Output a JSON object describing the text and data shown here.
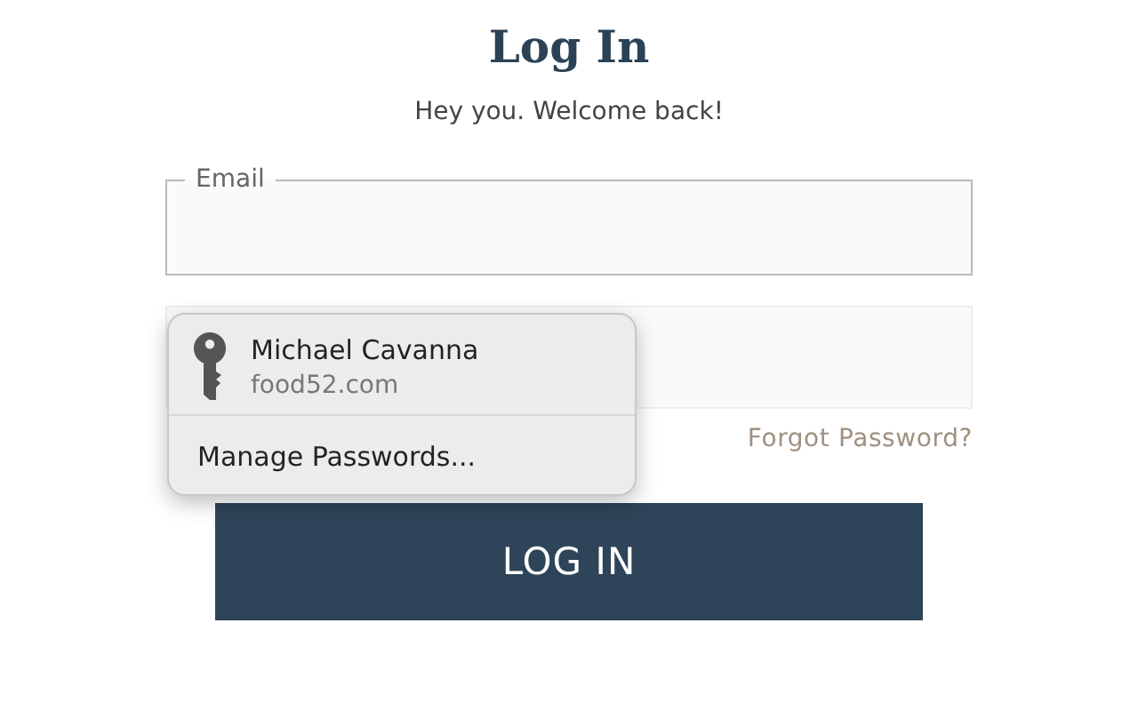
{
  "title": "Log In",
  "subtitle": "Hey you. Welcome back!",
  "email_field": {
    "label": "Email"
  },
  "forgot_link": "Forgot Password?",
  "submit_button": "LOG IN",
  "autofill_popup": {
    "credentials": [
      {
        "username": "Michael Cavanna",
        "domain": "food52.com"
      }
    ],
    "manage_label": "Manage Passwords..."
  }
}
